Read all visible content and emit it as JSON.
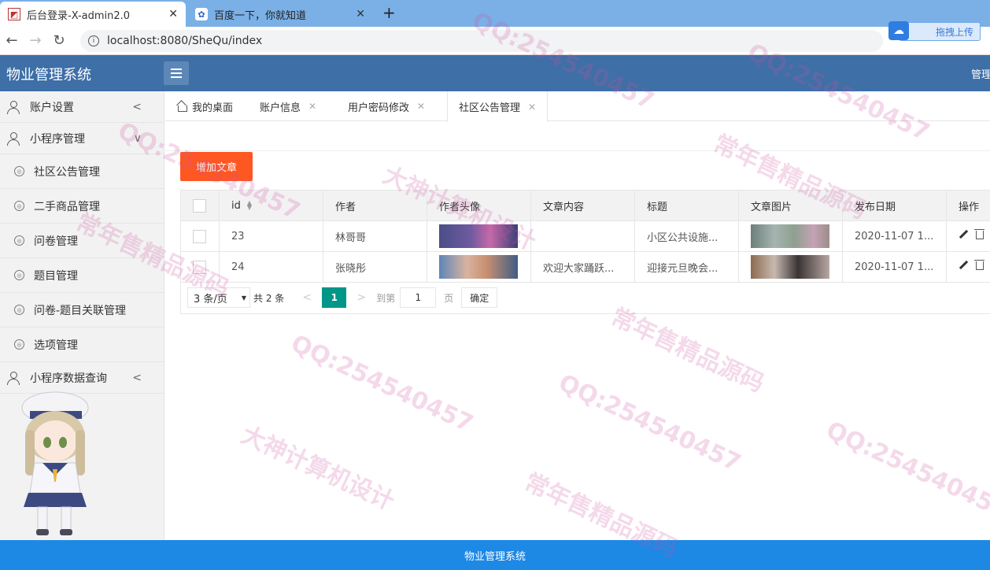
{
  "browser": {
    "tabs": [
      {
        "title": "后台登录-X-admin2.0",
        "close": "✕"
      },
      {
        "title": "百度一下，你就知道",
        "close": "✕"
      }
    ],
    "new_tab": "+",
    "url": "localhost:8080/SheQu/index",
    "extension_label": "拖拽上传"
  },
  "header": {
    "title": "物业管理系统",
    "user": "管理员"
  },
  "sidebar": {
    "items": [
      {
        "label": "账户设置",
        "type": "top",
        "arrow": "<"
      },
      {
        "label": "小程序管理",
        "type": "top",
        "arrow": "∨"
      },
      {
        "label": "社区公告管理",
        "type": "sub"
      },
      {
        "label": "二手商品管理",
        "type": "sub"
      },
      {
        "label": "问卷管理",
        "type": "sub"
      },
      {
        "label": "题目管理",
        "type": "sub"
      },
      {
        "label": "问卷-题目关联管理",
        "type": "sub"
      },
      {
        "label": "选项管理",
        "type": "sub"
      },
      {
        "label": "小程序数据查询",
        "type": "top",
        "arrow": "<"
      }
    ]
  },
  "content_tabs": [
    {
      "label": "我的桌面"
    },
    {
      "label": "账户信息",
      "close": "✕"
    },
    {
      "label": "用户密码修改",
      "close": "✕"
    },
    {
      "label": "社区公告管理",
      "close": "✕"
    }
  ],
  "toolbar": {
    "add_label": "增加文章"
  },
  "table": {
    "columns": [
      "id",
      "作者",
      "作者头像",
      "文章内容",
      "标题",
      "文章图片",
      "发布日期",
      "操作"
    ],
    "rows": [
      {
        "id": "23",
        "author": "林哥哥",
        "content": "",
        "title": "小区公共设施...",
        "date": "2020-11-07 1..."
      },
      {
        "id": "24",
        "author": "张晓彤",
        "content": "欢迎大家踊跃...",
        "title": "迎接元旦晚会...",
        "date": "2020-11-07 1..."
      }
    ]
  },
  "pager": {
    "page_size": "3 条/页",
    "total": "共 2 条",
    "prev": "<",
    "current": "1",
    "next": ">",
    "goto_label": "到第",
    "goto_value": "1",
    "page_label": "页",
    "confirm": "确定"
  },
  "footer": {
    "text": "物业管理系统"
  },
  "watermarks": [
    "QQ:254540457",
    "常年售精品源码",
    "大神计算机设计"
  ]
}
